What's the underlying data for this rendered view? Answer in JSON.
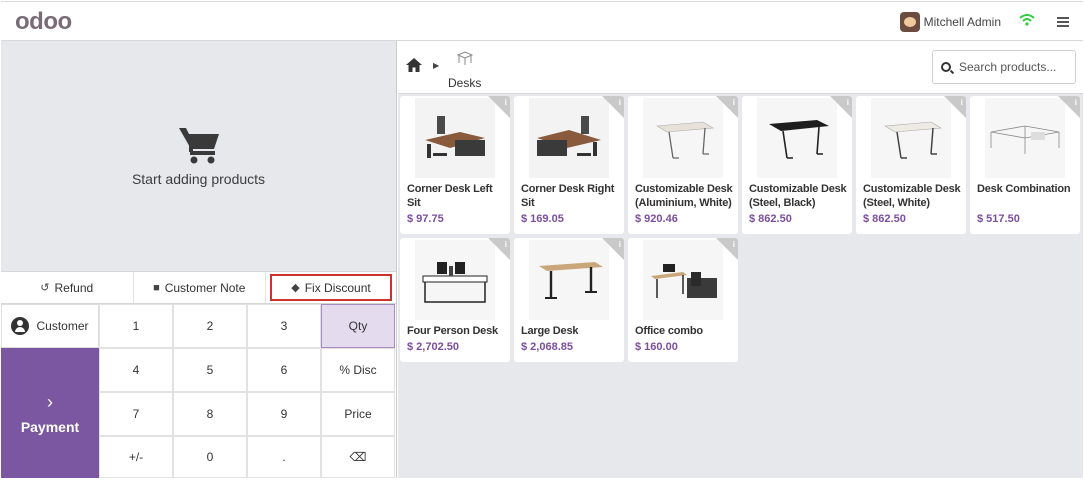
{
  "header": {
    "logo": "odoo",
    "user_name": "Mitchell Admin"
  },
  "order": {
    "empty_text": "Start adding products"
  },
  "controls": {
    "refund": "Refund",
    "customer_note": "Customer Note",
    "fix_discount": "Fix Discount"
  },
  "numpad": {
    "customer": "Customer",
    "payment": "Payment",
    "keys": [
      "1",
      "2",
      "3",
      "Qty",
      "4",
      "5",
      "6",
      "% Disc",
      "7",
      "8",
      "9",
      "Price",
      "+/-",
      "0",
      ".",
      "⌫"
    ]
  },
  "breadcrumb": {
    "category": "Desks"
  },
  "search": {
    "placeholder": "Search products..."
  },
  "products": [
    {
      "name": "Corner Desk Left Sit",
      "price": "$ 97.75",
      "image": "corner-desk-left"
    },
    {
      "name": "Corner Desk Right Sit",
      "price": "$ 169.05",
      "image": "corner-desk-right"
    },
    {
      "name": "Customizable Desk (Aluminium, White)",
      "price": "$ 920.46",
      "image": "desk-white-alu"
    },
    {
      "name": "Customizable Desk (Steel, Black)",
      "price": "$ 862.50",
      "image": "desk-black-steel"
    },
    {
      "name": "Customizable Desk (Steel, White)",
      "price": "$ 862.50",
      "image": "desk-white-steel"
    },
    {
      "name": "Desk Combination",
      "price": "$ 517.50",
      "image": "desk-combination"
    },
    {
      "name": "Four Person Desk",
      "price": "$ 2,702.50",
      "image": "four-person-desk"
    },
    {
      "name": "Large Desk",
      "price": "$ 2,068.85",
      "image": "large-desk"
    },
    {
      "name": "Office combo",
      "price": "$ 160.00",
      "image": "office-combo"
    }
  ],
  "colors": {
    "brand_purple": "#7b56a1",
    "price_purple": "#7b4f9d",
    "qty_selected": "#e5dbef",
    "highlight_red": "#d0312d"
  }
}
